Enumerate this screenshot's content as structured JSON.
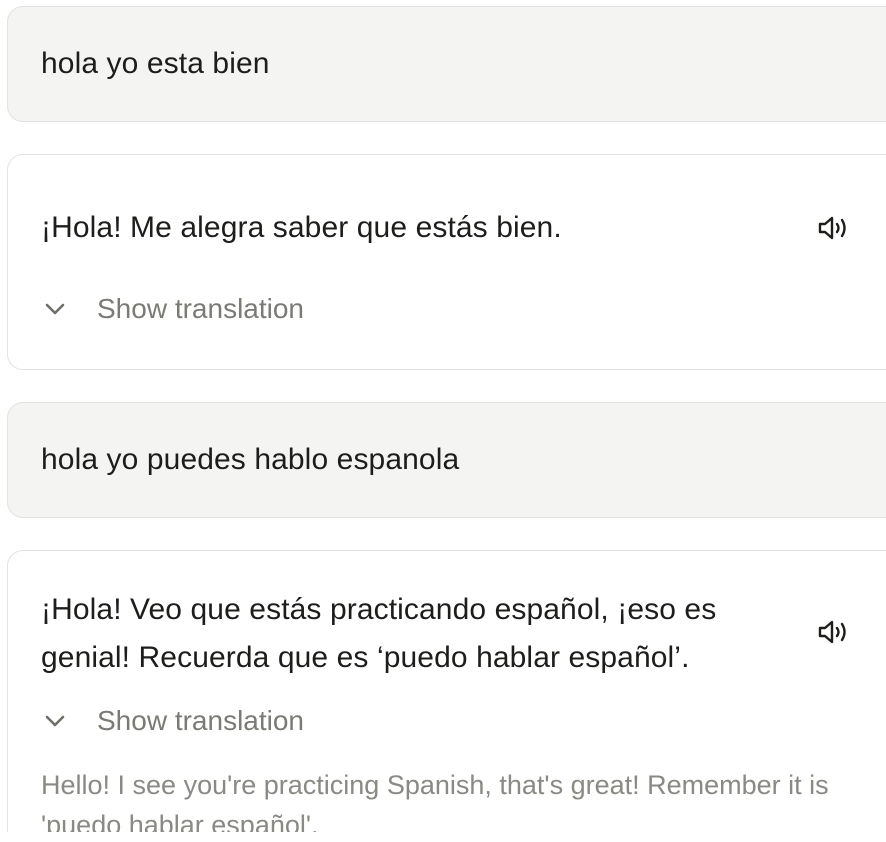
{
  "conversation": {
    "messages": [
      {
        "role": "user",
        "text": "hola yo esta bien"
      },
      {
        "role": "assistant",
        "text": "¡Hola! Me alegra saber que estás bien.",
        "toggle_label": "Show translation",
        "speaker_icon": "speaker-icon"
      },
      {
        "role": "user",
        "text": "hola yo puedes hablo espanola"
      },
      {
        "role": "assistant",
        "text": "¡Hola! Veo que estás practicando español, ¡eso es genial! Recuerda que es ‘puedo hablar español’.",
        "toggle_label": "Show translation",
        "translation": "Hello! I see you're practicing Spanish, that's great! Remember it is 'puedo hablar español'.",
        "speaker_icon": "speaker-icon"
      }
    ]
  },
  "colors": {
    "user_bubble_bg": "#f4f4f2",
    "assistant_bubble_bg": "#ffffff",
    "border": "#e3e3e0",
    "text": "#1d1d1b",
    "muted_text": "#7b7a75"
  }
}
